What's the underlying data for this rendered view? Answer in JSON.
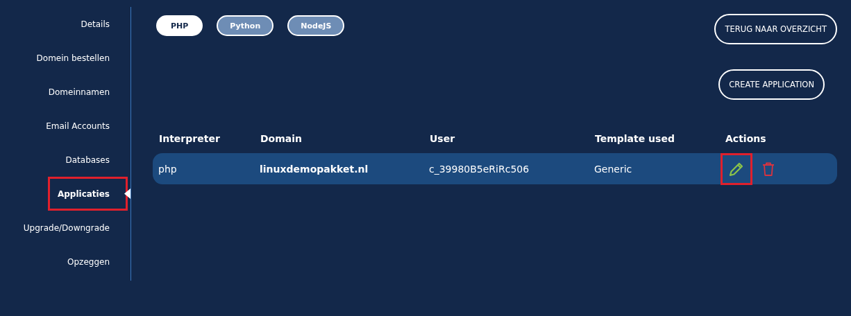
{
  "sidebar": {
    "items": [
      {
        "label": "Details",
        "selected": false,
        "highlighted": false
      },
      {
        "label": "Domein bestellen",
        "selected": false,
        "highlighted": false
      },
      {
        "label": "Domeinnamen",
        "selected": false,
        "highlighted": false
      },
      {
        "label": "Email Accounts",
        "selected": false,
        "highlighted": false
      },
      {
        "label": "Databases",
        "selected": false,
        "highlighted": false
      },
      {
        "label": "Applicaties",
        "selected": true,
        "highlighted": true
      },
      {
        "label": "Upgrade/Downgrade",
        "selected": false,
        "highlighted": false
      },
      {
        "label": "Opzeggen",
        "selected": false,
        "highlighted": false
      }
    ]
  },
  "tabs": [
    {
      "label": "PHP",
      "selected": true
    },
    {
      "label": "Python",
      "selected": false
    },
    {
      "label": "NodeJS",
      "selected": false
    }
  ],
  "back_button": "TERUG NAAR OVERZICHT",
  "create_button": "CREATE APPLICATION",
  "table": {
    "columns": [
      "Interpreter",
      "Domain",
      "User",
      "Template used",
      "Actions"
    ],
    "rows": [
      {
        "interpreter": "php",
        "domain": "linuxdemopakket.nl",
        "user": "c_39980B5eRiRc506",
        "template": "Generic",
        "actions": [
          {
            "kind": "edit",
            "highlighted": true
          },
          {
            "kind": "delete",
            "highlighted": false
          }
        ]
      }
    ]
  }
}
